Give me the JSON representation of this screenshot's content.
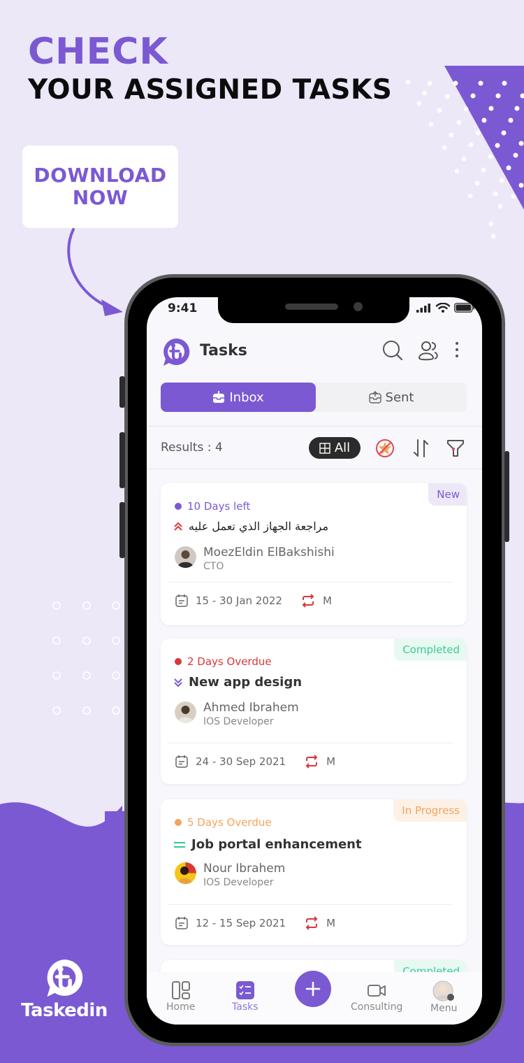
{
  "promo": {
    "headline_accent": "CHECK",
    "headline_main": "YOUR ASSIGNED TASKS",
    "cta_line1": "DOWNLOAD",
    "cta_line2": "NOW",
    "brand_name": "Taskedin"
  },
  "colors": {
    "brand_purple": "#7b59d3",
    "background": "#ece8f8",
    "overdue_red": "#d9373b",
    "overdue_orange": "#f5a35c",
    "completed_green": "#3cc99a"
  },
  "status_bar": {
    "time": "9:41"
  },
  "header": {
    "title": "Tasks",
    "icons": [
      "search-icon",
      "users-icon",
      "more-vertical-icon"
    ]
  },
  "tabs": [
    {
      "label": "Inbox",
      "active": true,
      "icon": "inbox-icon"
    },
    {
      "label": "Sent",
      "active": false,
      "icon": "sent-icon"
    }
  ],
  "filter_bar": {
    "results_label": "Results : 4",
    "all_label": "All",
    "icons": [
      "grid-icon",
      "no-star-icon",
      "sort-icon",
      "filter-icon"
    ]
  },
  "tasks": [
    {
      "due_text": "10 Days left",
      "due_color": "#7b59d3",
      "priority": "high",
      "title": "مراجعة الجهاز الذي تعمل عليه",
      "assignee_name": "MoezEldin ElBakshishi",
      "assignee_role": "CTO",
      "date_range": "15 - 30 Jan 2022",
      "repeat": "M",
      "status": "New",
      "status_color": "#7b59d3",
      "status_bg": "#ece8f8"
    },
    {
      "due_text": "2 Days Overdue",
      "due_color": "#d9373b",
      "priority": "low",
      "title": "New app design",
      "assignee_name": "Ahmed Ibrahem",
      "assignee_role": "IOS Developer",
      "date_range": "24 - 30 Sep 2021",
      "repeat": "M",
      "status": "Completed",
      "status_color": "#3cc99a",
      "status_bg": "#e8f9f2"
    },
    {
      "due_text": "5 Days Overdue",
      "due_color": "#f5a35c",
      "priority": "medium",
      "title": "Job portal enhancement",
      "assignee_name": "Nour Ibrahem",
      "assignee_role": "IOS Developer",
      "date_range": "12 - 15 Sep 2021",
      "repeat": "M",
      "status": "In Progress",
      "status_color": "#f5a35c",
      "status_bg": "#fdf1e6"
    },
    {
      "status": "Completed",
      "status_color": "#3cc99a",
      "status_bg": "#e8f9f2"
    }
  ],
  "bottom_nav": [
    {
      "label": "Home",
      "icon": "home-grid-icon",
      "active": false
    },
    {
      "label": "Tasks",
      "icon": "tasks-checklist-icon",
      "active": true
    },
    {
      "label": "",
      "icon": "plus-icon",
      "active": false
    },
    {
      "label": "Consulting",
      "icon": "video-icon",
      "active": false
    },
    {
      "label": "Menu",
      "icon": "avatar-icon",
      "active": false
    }
  ]
}
